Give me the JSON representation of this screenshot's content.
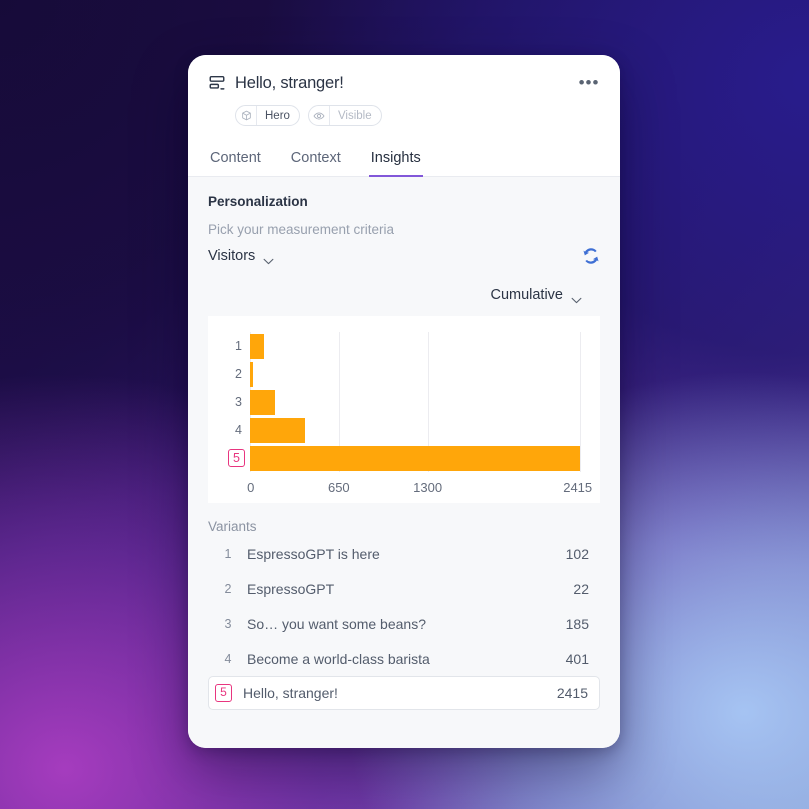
{
  "header": {
    "title": "Hello, stranger!",
    "title_icon": "layout-section-icon",
    "more_menu": "•••",
    "badges": [
      {
        "icon": "cube-icon",
        "label": "Hero",
        "muted": false
      },
      {
        "icon": "eye-icon",
        "label": "Visible",
        "muted": true
      }
    ]
  },
  "tabs": [
    {
      "label": "Content",
      "active": false
    },
    {
      "label": "Context",
      "active": false
    },
    {
      "label": "Insights",
      "active": true
    }
  ],
  "personalization": {
    "section_title": "Personalization",
    "sub_label": "Pick your measurement criteria",
    "metric_dropdown": "Visitors",
    "refresh_icon": "refresh-icon",
    "aggregation_dropdown": "Cumulative"
  },
  "chart_data": {
    "type": "bar",
    "orientation": "horizontal",
    "title": "",
    "xlabel": "",
    "ylabel": "",
    "categories": [
      "1",
      "2",
      "3",
      "4",
      "5"
    ],
    "values": [
      102,
      22,
      185,
      401,
      2415
    ],
    "xticks": [
      "0",
      "650",
      "1300",
      "2415"
    ],
    "xtick_values": [
      0,
      650,
      1300,
      2415
    ],
    "xlim": [
      0,
      2415
    ],
    "grid": true,
    "legend": "none",
    "bar_color": "#ffa60a",
    "highlighted_category": "5",
    "highlight_color": "#e8357f"
  },
  "variants": {
    "title": "Variants",
    "rows": [
      {
        "num": "1",
        "label": "EspressoGPT is here",
        "value": "102",
        "selected": false
      },
      {
        "num": "2",
        "label": "EspressoGPT",
        "value": "22",
        "selected": false
      },
      {
        "num": "3",
        "label": "So… you want some beans?",
        "value": "185",
        "selected": false
      },
      {
        "num": "4",
        "label": "Become a world-class barista",
        "value": "401",
        "selected": false
      },
      {
        "num": "5",
        "label": "Hello, stranger!",
        "value": "2415",
        "selected": true
      }
    ]
  },
  "colors": {
    "accent_purple": "#8257d9",
    "bar_orange": "#ffa60a",
    "highlight_pink": "#e8357f",
    "refresh_blue": "#3e6fd4"
  }
}
